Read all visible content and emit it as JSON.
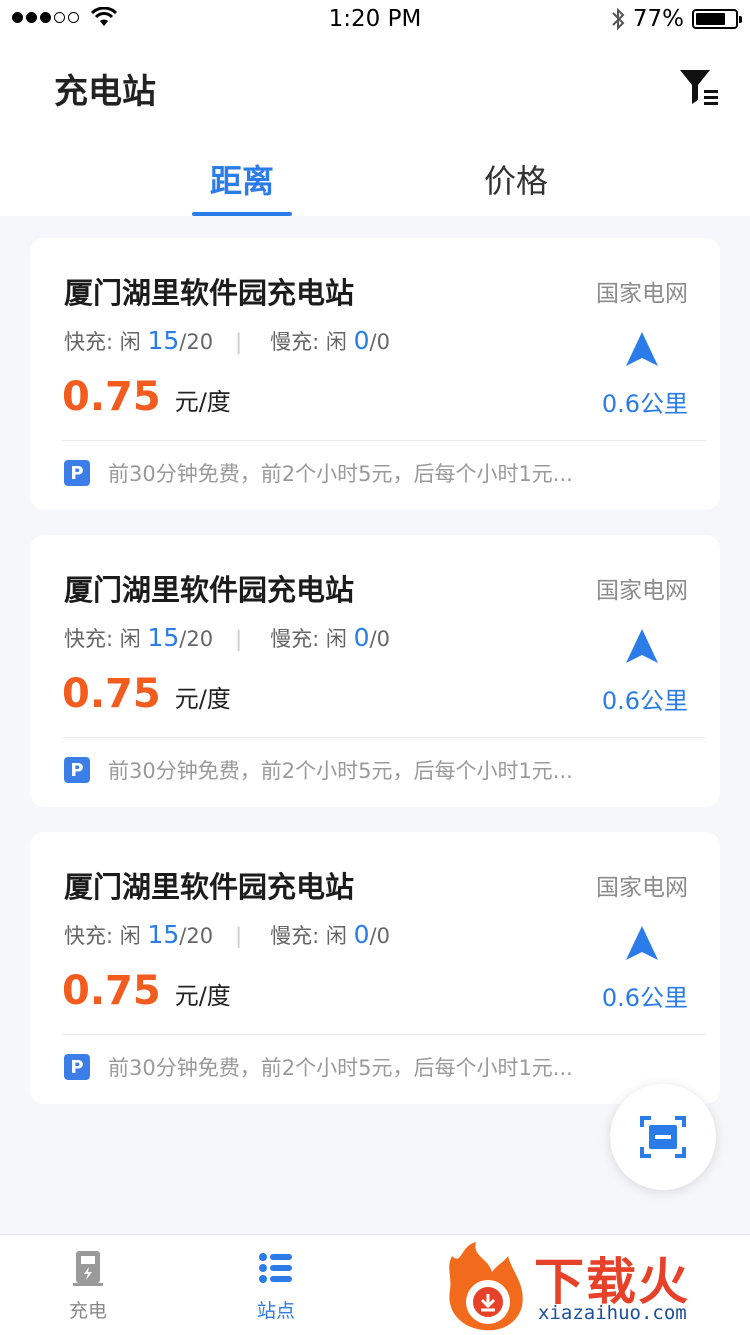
{
  "status_bar": {
    "time": "1:20 PM",
    "battery": "77%",
    "battery_level": 0.77,
    "signal_bars": 3,
    "icons": [
      "signal-dots-icon",
      "wifi-icon",
      "bluetooth-icon",
      "battery-icon"
    ]
  },
  "header": {
    "title": "充电站",
    "filter_icon": "filter-icon"
  },
  "tabs": [
    {
      "label": "距离",
      "active": true
    },
    {
      "label": "价格",
      "active": false
    }
  ],
  "stations": [
    {
      "name": "厦门湖里软件园充电站",
      "operator": "国家电网",
      "fast_label": "快充:",
      "fast_idle_label": "闲",
      "fast_idle": "15",
      "fast_total": "/20",
      "slow_label": "慢充:",
      "slow_idle_label": "闲",
      "slow_idle": "0",
      "slow_total": "/0",
      "price": "0.75",
      "price_unit": "元/度",
      "distance": "0.6公里",
      "parking_badge": "P",
      "parking_note": "前30分钟免费，前2个小时5元，后每个小时1元..."
    },
    {
      "name": "厦门湖里软件园充电站",
      "operator": "国家电网",
      "fast_label": "快充:",
      "fast_idle_label": "闲",
      "fast_idle": "15",
      "fast_total": "/20",
      "slow_label": "慢充:",
      "slow_idle_label": "闲",
      "slow_idle": "0",
      "slow_total": "/0",
      "price": "0.75",
      "price_unit": "元/度",
      "distance": "0.6公里",
      "parking_badge": "P",
      "parking_note": "前30分钟免费，前2个小时5元，后每个小时1元..."
    },
    {
      "name": "厦门湖里软件园充电站",
      "operator": "国家电网",
      "fast_label": "快充:",
      "fast_idle_label": "闲",
      "fast_idle": "15",
      "fast_total": "/20",
      "slow_label": "慢充:",
      "slow_idle_label": "闲",
      "slow_idle": "0",
      "slow_total": "/0",
      "price": "0.75",
      "price_unit": "元/度",
      "distance": "0.6公里",
      "parking_badge": "P",
      "parking_note": "前30分钟免费，前2个小时5元，后每个小时1元..."
    }
  ],
  "tabbar": [
    {
      "label": "充电",
      "icon": "charging-pile-icon",
      "active": false
    },
    {
      "label": "站点",
      "icon": "list-icon",
      "active": true
    }
  ],
  "watermark": {
    "text": "下载火",
    "url": "xiazaihuo.com"
  },
  "colors": {
    "accent": "#2b7ce9",
    "price": "#f25c1e",
    "background": "#f5f7fa"
  }
}
